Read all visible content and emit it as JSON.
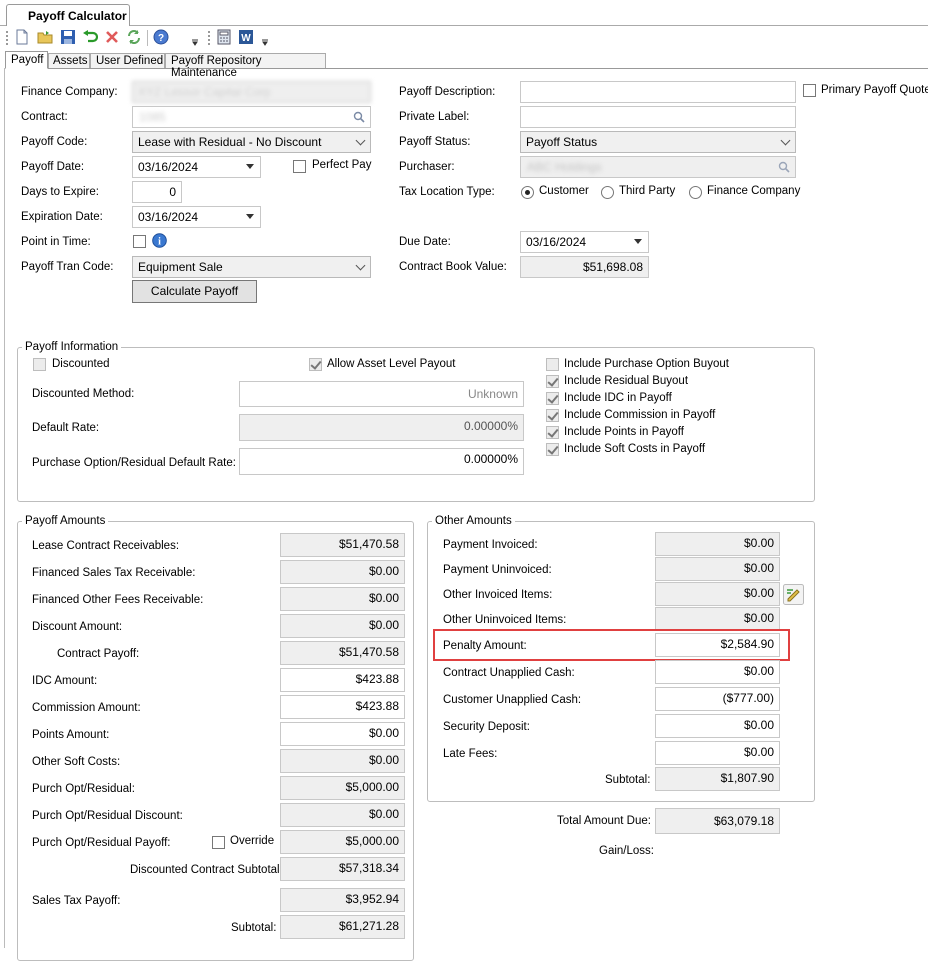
{
  "window": {
    "tab_title": "Payoff Calculator"
  },
  "tabs": [
    {
      "label": "Payoff"
    },
    {
      "label": "Assets"
    },
    {
      "label": "User Defined"
    },
    {
      "label": "Payoff Repository Maintenance"
    }
  ],
  "left_form": {
    "finance_company": {
      "label": "Finance Company:",
      "value": "XYZ Lessor Capital Corp"
    },
    "contract": {
      "label": "Contract:",
      "value": "1085"
    },
    "payoff_code": {
      "label": "Payoff Code:",
      "value": "Lease with Residual - No Discount"
    },
    "payoff_date": {
      "label": "Payoff Date:",
      "value": "03/16/2024"
    },
    "perfect_pay": {
      "label": "Perfect Pay",
      "checked": false
    },
    "days_to_expire": {
      "label": "Days to Expire:",
      "value": "0"
    },
    "expiration_date": {
      "label": "Expiration Date:",
      "value": "03/16/2024"
    },
    "point_in_time": {
      "label": "Point in Time:",
      "checked": false
    },
    "payoff_tran_code": {
      "label": "Payoff Tran Code:",
      "value": "Equipment Sale"
    },
    "calculate_button": "Calculate Payoff"
  },
  "right_form": {
    "payoff_description": {
      "label": "Payoff Description:",
      "value": ""
    },
    "primary_payoff_quote": {
      "label": "Primary Payoff Quote",
      "checked": false
    },
    "private_label": {
      "label": "Private Label:",
      "value": ""
    },
    "payoff_status": {
      "label": "Payoff Status:",
      "value": "Payoff Status"
    },
    "purchaser": {
      "label": "Purchaser:",
      "value": "ABC Holdings"
    },
    "tax_location_type": {
      "label": "Tax Location Type:",
      "options": [
        "Customer",
        "Third Party",
        "Finance Company"
      ],
      "selected": "Customer"
    },
    "due_date": {
      "label": "Due Date:",
      "value": "03/16/2024"
    },
    "contract_book_value": {
      "label": "Contract Book Value:",
      "value": "$51,698.08"
    }
  },
  "payoff_information": {
    "title": "Payoff Information",
    "discounted": {
      "label": "Discounted",
      "checked": false,
      "disabled": true
    },
    "allow_asset_level_payout": {
      "label": "Allow Asset Level Payout",
      "checked": true
    },
    "discounted_method": {
      "label": "Discounted Method:",
      "value": "Unknown"
    },
    "default_rate": {
      "label": "Default Rate:",
      "value": "0.00000%"
    },
    "purchase_option_default_rate": {
      "label": "Purchase Option/Residual Default Rate:",
      "value": "0.00000%"
    },
    "includes": [
      {
        "label": "Include Purchase Option Buyout",
        "checked": false
      },
      {
        "label": "Include Residual Buyout",
        "checked": true
      },
      {
        "label": "Include IDC in Payoff",
        "checked": true
      },
      {
        "label": "Include Commission in Payoff",
        "checked": true
      },
      {
        "label": "Include Points in Payoff",
        "checked": true
      },
      {
        "label": "Include Soft Costs in Payoff",
        "checked": true
      }
    ]
  },
  "payoff_amounts": {
    "title": "Payoff Amounts",
    "rows": [
      {
        "label": "Lease Contract Receivables:",
        "value": "$51,470.58"
      },
      {
        "label": "Financed Sales Tax Receivable:",
        "value": "$0.00"
      },
      {
        "label": "Financed Other Fees Receivable:",
        "value": "$0.00"
      },
      {
        "label": "Discount Amount:",
        "value": "$0.00"
      },
      {
        "label": "Contract Payoff:",
        "value": "$51,470.58"
      },
      {
        "label": "IDC Amount:",
        "value": "$423.88"
      },
      {
        "label": "Commission Amount:",
        "value": "$423.88"
      },
      {
        "label": "Points Amount:",
        "value": "$0.00"
      },
      {
        "label": "Other Soft Costs:",
        "value": "$0.00"
      },
      {
        "label": "Purch Opt/Residual:",
        "value": "$5,000.00"
      },
      {
        "label": "Purch Opt/Residual Discount:",
        "value": "$0.00"
      },
      {
        "label": "Purch Opt/Residual Payoff:",
        "value": "$5,000.00"
      },
      {
        "label": "Discounted Contract Subtotal:",
        "value": "$57,318.34"
      },
      {
        "label": "Sales Tax Payoff:",
        "value": "$3,952.94"
      },
      {
        "label": "Subtotal:",
        "value": "$61,271.28"
      }
    ],
    "override": {
      "label": "Override",
      "checked": false
    }
  },
  "other_amounts": {
    "title": "Other Amounts",
    "rows": [
      {
        "label": "Payment Invoiced:",
        "value": "$0.00"
      },
      {
        "label": "Payment Uninvoiced:",
        "value": "$0.00"
      },
      {
        "label": "Other Invoiced Items:",
        "value": "$0.00"
      },
      {
        "label": "Other Uninvoiced Items:",
        "value": "$0.00"
      },
      {
        "label": "Penalty Amount:",
        "value": "$2,584.90"
      },
      {
        "label": "Contract Unapplied Cash:",
        "value": "$0.00"
      },
      {
        "label": "Customer Unapplied Cash:",
        "value": "($777.00)"
      },
      {
        "label": "Security Deposit:",
        "value": "$0.00"
      },
      {
        "label": "Late Fees:",
        "value": "$0.00"
      },
      {
        "label": "Subtotal:",
        "value": "$1,807.90"
      }
    ]
  },
  "totals": {
    "total_amount_due": {
      "label": "Total Amount Due:",
      "value": "$63,079.18"
    },
    "gain_loss": {
      "label": "Gain/Loss:"
    }
  },
  "colors": {
    "highlight": "#e04040",
    "tab_bg": "#f3f3f3",
    "readonly_bg": "#efefef"
  }
}
